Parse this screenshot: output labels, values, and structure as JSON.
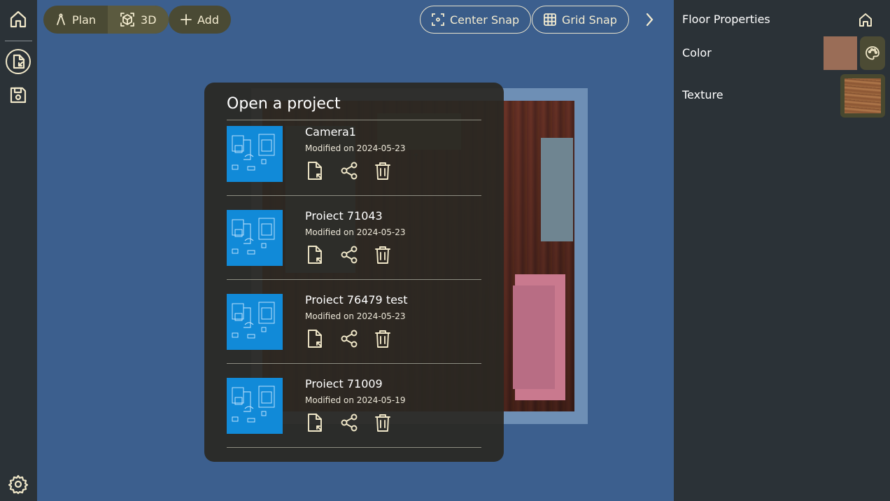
{
  "toolbar": {
    "plan_label": "Plan",
    "three_d_label": "3D",
    "add_label": "Add",
    "center_snap_label": "Center Snap",
    "grid_snap_label": "Grid Snap"
  },
  "left_rail": {
    "items": [
      "home-icon",
      "open-file-icon",
      "save-icon",
      "settings-icon"
    ]
  },
  "modal": {
    "title": "Open a project",
    "projects": [
      {
        "name": "Camera1",
        "modified": "Modified on 2024-05-23"
      },
      {
        "name": "Proiect 71043",
        "modified": "Modified on 2024-05-23"
      },
      {
        "name": "Proiect 76479 test",
        "modified": "Modified on 2024-05-23"
      },
      {
        "name": "Proiect 71009",
        "modified": "Modified on 2024-05-19"
      }
    ]
  },
  "right_panel": {
    "title": "Floor Properties",
    "color_label": "Color",
    "texture_label": "Texture",
    "color_value": "#9a6d57"
  },
  "colors": {
    "rail_bg": "#2b3237",
    "canvas_bg": "#3c5f8e",
    "accent": "#f1e8c9",
    "thumb_bg": "#118ad8"
  }
}
